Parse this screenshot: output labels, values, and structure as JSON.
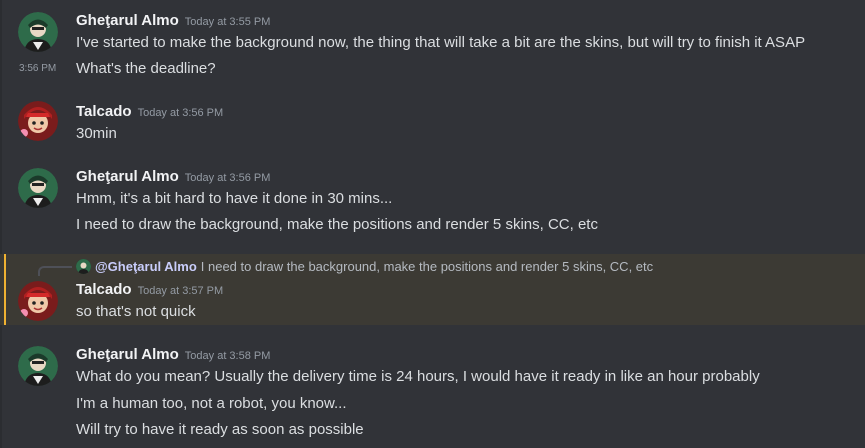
{
  "messages": [
    {
      "username": "Gheţarul Almo",
      "timestamp": "Today at 3:55 PM",
      "lines": [
        "I've started to make the background now, the thing that will take a bit are the skins, but will try to finish it ASAP"
      ]
    },
    {
      "hover_time": "3:56 PM",
      "lines": [
        "What's the deadline?"
      ]
    },
    {
      "username": "Talcado",
      "timestamp": "Today at 3:56 PM",
      "lines": [
        "30min"
      ]
    },
    {
      "username": "Gheţarul Almo",
      "timestamp": "Today at 3:56 PM",
      "lines": [
        "Hmm, it's a bit hard to have it done in 30 mins...",
        "I need to draw the background, make the positions and render 5 skins, CC, etc"
      ]
    },
    {
      "reply": {
        "mention": "@Gheţarul Almo",
        "text": "I need to draw the background, make the positions and render 5 skins, CC, etc"
      },
      "username": "Talcado",
      "timestamp": "Today at 3:57 PM",
      "lines": [
        "so that's not quick"
      ]
    },
    {
      "username": "Gheţarul Almo",
      "timestamp": "Today at 3:58 PM",
      "lines": [
        "What do you mean? Usually the delivery time is 24 hours, I would have it ready in like an hour probably",
        "I'm a human too, not a robot, you know...",
        "Will try to have it ready as soon as possible"
      ]
    }
  ],
  "colors": {
    "background": "#313338",
    "reply_highlight": "#3c3a34",
    "reply_accent": "#f0b232",
    "mention": "#c9cdfb"
  },
  "icons": {
    "avatar_almo": "avatar-almo",
    "avatar_talcado": "avatar-talcado"
  }
}
